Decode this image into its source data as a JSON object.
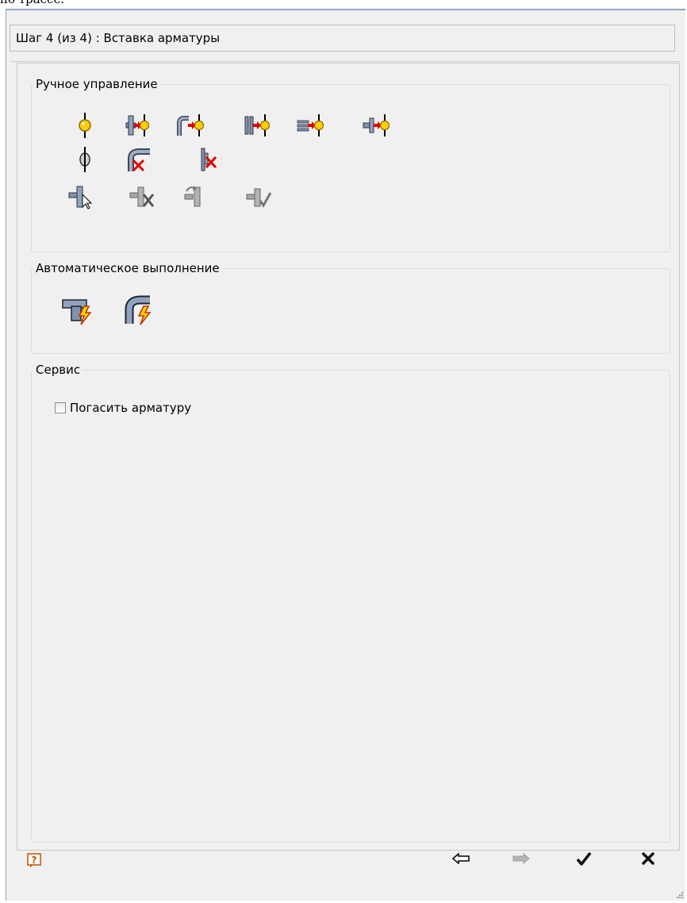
{
  "page": {
    "top_text": "по трассе."
  },
  "step": {
    "label": "Шаг 4 (из 4) : Вставка арматуры"
  },
  "groups": {
    "manual": {
      "title": "Ручное управление",
      "tools": [
        {
          "icon": "valve-insert-icon"
        },
        {
          "icon": "valve-insert-tee-icon"
        },
        {
          "icon": "valve-insert-elbow-icon"
        },
        {
          "icon": "valve-insert-flange-icon"
        },
        {
          "icon": "valve-insert-coupling-icon"
        },
        {
          "icon": "valve-insert-union-icon"
        },
        {
          "icon": "valve-axis-icon"
        },
        {
          "icon": "delete-elbow-icon"
        },
        {
          "icon": "delete-flange-icon"
        },
        {
          "icon": "select-fitting-icon"
        },
        {
          "icon": "cut-fitting-icon"
        },
        {
          "icon": "rotate-fitting-icon"
        },
        {
          "icon": "check-fitting-icon"
        }
      ]
    },
    "auto": {
      "title": "Автоматическое выполнение",
      "tools": [
        {
          "icon": "auto-tee-icon"
        },
        {
          "icon": "auto-elbow-icon"
        }
      ]
    },
    "service": {
      "title": "Сервис",
      "checkbox_label": "Погасить арматуру",
      "checkbox_checked": false
    }
  },
  "footer": {
    "help_icon": "help-icon",
    "back_icon": "back-arrow-icon",
    "next_icon": "next-arrow-icon",
    "ok_icon": "checkmark-icon",
    "cancel_icon": "cancel-x-icon"
  }
}
